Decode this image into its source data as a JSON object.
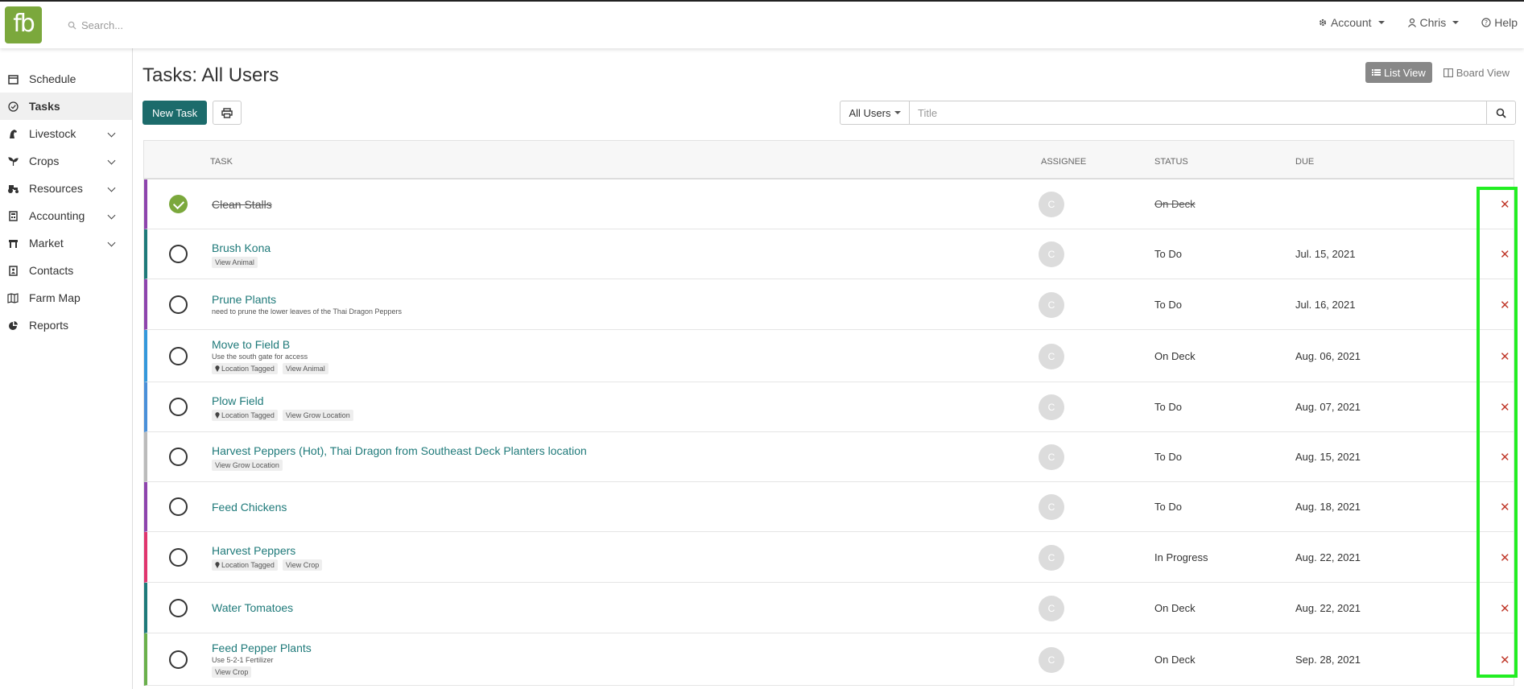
{
  "app": {
    "logo_text": "fb",
    "brand_color": "#7ba83c",
    "accent_color": "#1c6b6b"
  },
  "search": {
    "placeholder": "Search..."
  },
  "topnav": {
    "account": "Account",
    "user": "Chris",
    "help": "Help"
  },
  "sidebar": {
    "items": [
      {
        "label": "Schedule",
        "icon": "calendar-icon"
      },
      {
        "label": "Tasks",
        "icon": "check-circle-icon",
        "active": true
      },
      {
        "label": "Livestock",
        "icon": "horse-icon",
        "expandable": true
      },
      {
        "label": "Crops",
        "icon": "seedling-icon",
        "expandable": true
      },
      {
        "label": "Resources",
        "icon": "tractor-icon",
        "expandable": true
      },
      {
        "label": "Accounting",
        "icon": "calculator-icon",
        "expandable": true
      },
      {
        "label": "Market",
        "icon": "store-icon",
        "expandable": true
      },
      {
        "label": "Contacts",
        "icon": "address-book-icon"
      },
      {
        "label": "Farm Map",
        "icon": "map-icon"
      },
      {
        "label": "Reports",
        "icon": "pie-chart-icon"
      }
    ]
  },
  "page": {
    "title": "Tasks: All Users"
  },
  "view": {
    "list": "List View",
    "board": "Board View"
  },
  "toolbar": {
    "new_task": "New Task",
    "users_filter": "All Users",
    "title_placeholder": "Title"
  },
  "table": {
    "headers": {
      "task": "TASK",
      "assignee": "ASSIGNEE",
      "status": "STATUS",
      "due": "DUE"
    },
    "rows": [
      {
        "title": "Clean Stalls",
        "note": "",
        "tags": [],
        "assignee": "C",
        "status": "On Deck",
        "due": "",
        "done": true,
        "color": "#8e44ad"
      },
      {
        "title": "Brush Kona",
        "note": "",
        "tags": [
          "View Animal"
        ],
        "assignee": "C",
        "status": "To Do",
        "due": "Jul. 15, 2021",
        "done": false,
        "color": "#1f7a7a"
      },
      {
        "title": "Prune Plants",
        "note": "need to prune the lower leaves of the Thai Dragon Peppers",
        "tags": [],
        "assignee": "C",
        "status": "To Do",
        "due": "Jul. 16, 2021",
        "done": false,
        "color": "#8e44ad"
      },
      {
        "title": "Move to Field B",
        "note": "Use the south gate for access",
        "tags": [
          "Location Tagged",
          "View Animal"
        ],
        "assignee": "C",
        "status": "On Deck",
        "due": "Aug. 06, 2021",
        "done": false,
        "color": "#3498db"
      },
      {
        "title": "Plow Field",
        "note": "",
        "tags": [
          "Location Tagged",
          "View Grow Location"
        ],
        "assignee": "C",
        "status": "To Do",
        "due": "Aug. 07, 2021",
        "done": false,
        "color": "#4a90d9"
      },
      {
        "title": "Harvest Peppers (Hot), Thai Dragon from Southeast Deck Planters location",
        "note": "",
        "tags": [
          "View Grow Location"
        ],
        "assignee": "C",
        "status": "To Do",
        "due": "Aug. 15, 2021",
        "done": false,
        "color": "#bbbbbb"
      },
      {
        "title": "Feed Chickens",
        "note": "",
        "tags": [],
        "assignee": "C",
        "status": "To Do",
        "due": "Aug. 18, 2021",
        "done": false,
        "color": "#8e44ad"
      },
      {
        "title": "Harvest Peppers",
        "note": "",
        "tags": [
          "Location Tagged",
          "View Crop"
        ],
        "assignee": "C",
        "status": "In Progress",
        "due": "Aug. 22, 2021",
        "done": false,
        "color": "#e0356e"
      },
      {
        "title": "Water Tomatoes",
        "note": "",
        "tags": [],
        "assignee": "C",
        "status": "On Deck",
        "due": "Aug. 22, 2021",
        "done": false,
        "color": "#1f7a7a"
      },
      {
        "title": "Feed Pepper Plants",
        "note": "Use 5-2-1 Fertilizer",
        "tags": [
          "View Crop"
        ],
        "assignee": "C",
        "status": "On Deck",
        "due": "Sep. 28, 2021",
        "done": false,
        "color": "#6ab04c"
      }
    ]
  }
}
